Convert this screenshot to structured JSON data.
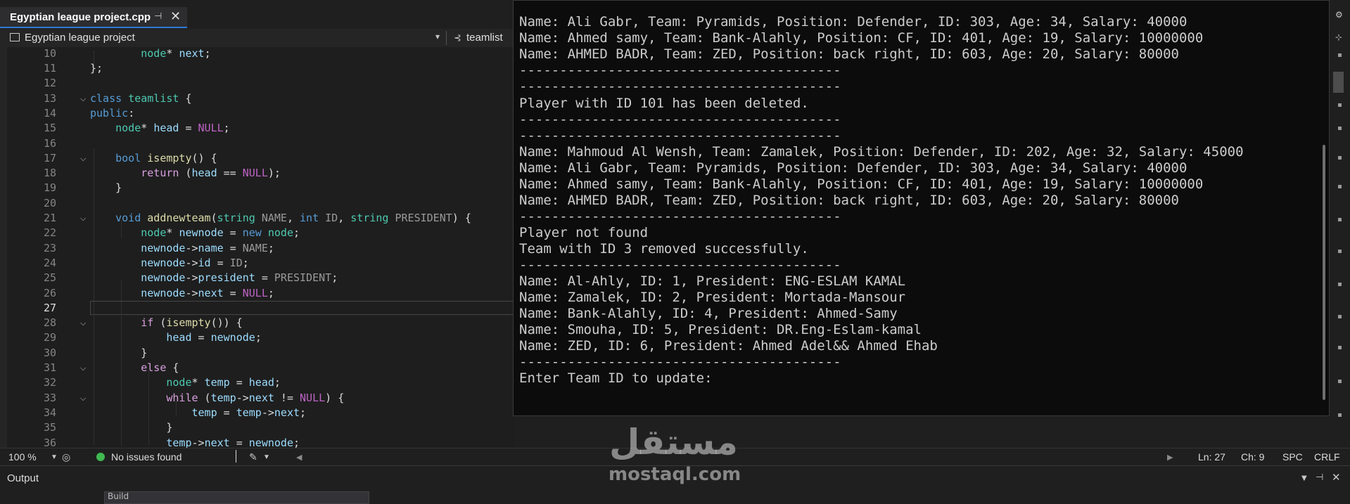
{
  "tab": {
    "title": "Egyptian league project.cpp",
    "pin_glyph": "⊣",
    "close_glyph": "✕"
  },
  "navbar": {
    "project": "Egyptian league project",
    "scope": "teamlist"
  },
  "editor": {
    "line_numbers": [
      "10",
      "11",
      "12",
      "13",
      "14",
      "15",
      "16",
      "17",
      "18",
      "19",
      "20",
      "21",
      "22",
      "23",
      "24",
      "25",
      "26",
      "27",
      "28",
      "29",
      "30",
      "31",
      "32",
      "33",
      "34",
      "35",
      "36"
    ],
    "current_line": "27"
  },
  "console": {
    "lines": [
      "Name: Ali Gabr, Team: Pyramids, Position: Defender, ID: 303, Age: 34, Salary: 40000",
      "Name: Ahmed samy, Team: Bank-Alahly, Position: CF, ID: 401, Age: 19, Salary: 10000000",
      "Name: AHMED BADR, Team: ZED, Position: back right, ID: 603, Age: 20, Salary: 80000",
      "----------------------------------------",
      "----------------------------------------",
      "Player with ID 101 has been deleted.",
      "----------------------------------------",
      "----------------------------------------",
      "Name: Mahmoud Al Wensh, Team: Zamalek, Position: Defender, ID: 202, Age: 32, Salary: 45000",
      "Name: Ali Gabr, Team: Pyramids, Position: Defender, ID: 303, Age: 34, Salary: 40000",
      "Name: Ahmed samy, Team: Bank-Alahly, Position: CF, ID: 401, Age: 19, Salary: 10000000",
      "Name: AHMED BADR, Team: ZED, Position: back right, ID: 603, Age: 20, Salary: 80000",
      "----------------------------------------",
      "Player not found",
      "Team with ID 3 removed successfully.",
      "----------------------------------------",
      "Name: Al-Ahly, ID: 1, President: ENG-ESLAM KAMAL",
      "Name: Zamalek, ID: 2, President: Mortada-Mansour",
      "Name: Bank-Alahly, ID: 4, President: Ahmed-Samy",
      "Name: Smouha, ID: 5, President: DR.Eng-Eslam-kamal",
      "Name: ZED, ID: 6, President: Ahmed Adel&& Ahmed Ehab",
      "----------------------------------------",
      "Enter Team ID to update:"
    ]
  },
  "status": {
    "zoom": "100 %",
    "issues": "No issues found",
    "ln": "Ln: 27",
    "ch": "Ch: 9",
    "spc": "SPC",
    "eol": "CRLF"
  },
  "output": {
    "title": "Output",
    "source": "Build"
  },
  "watermark": {
    "arabic": "مستقل",
    "latin": "mostaql.com"
  }
}
